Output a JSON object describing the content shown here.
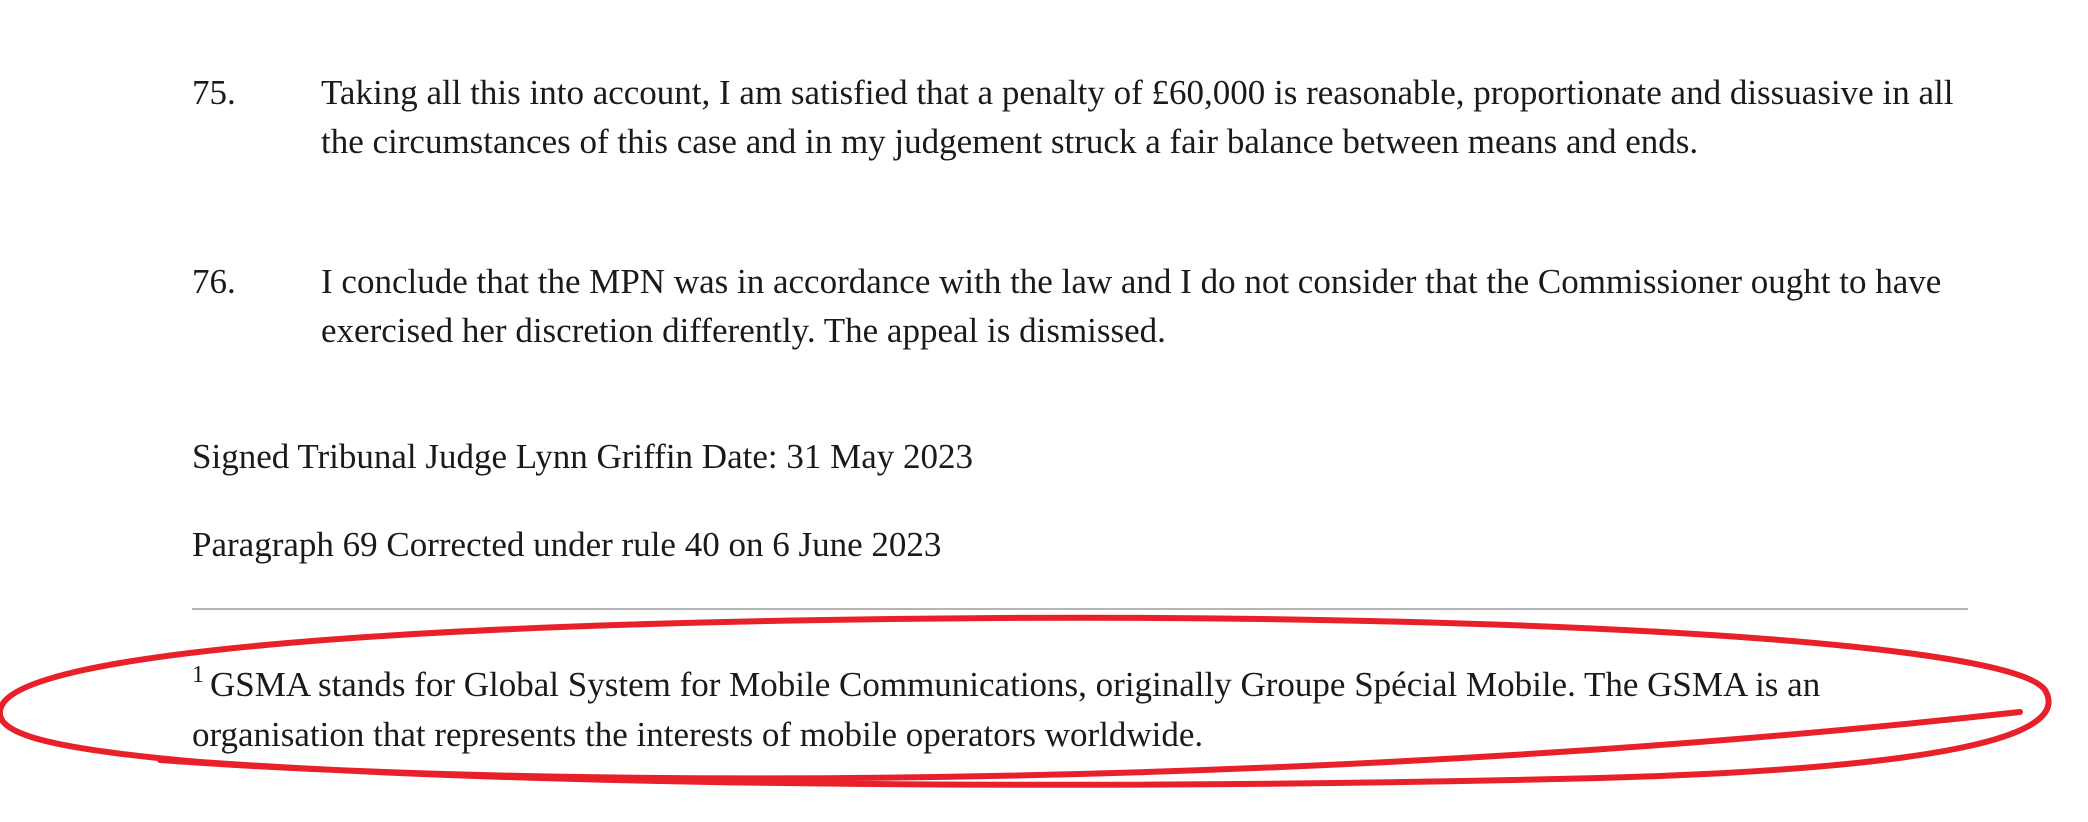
{
  "paragraphs": [
    {
      "number": "75.",
      "text": "Taking all this into account, I am satisfied that a penalty of £60,000 is reasonable, proportionate and dissuasive in all the circumstances of this case and in my judgement struck a fair balance between means and ends."
    },
    {
      "number": "76.",
      "text": "I conclude that the MPN was in accordance with the law and I do not consider that the Commissioner ought to have exercised her discretion differently. The appeal is dismissed."
    }
  ],
  "signature_line": "Signed Tribunal Judge Lynn Griffin Date: 31 May 2023",
  "correction_line": "Paragraph 69 Corrected under rule 40 on 6 June 2023",
  "footnote": {
    "marker": "1",
    "text": "GSMA stands for Global System for Mobile Communications, originally Groupe Spécial Mobile. The GSMA is an organisation that represents the interests of mobile operators worldwide."
  },
  "annotation": {
    "shape": "hand-drawn ellipse",
    "color": "#e8202a",
    "target": "footnote"
  }
}
